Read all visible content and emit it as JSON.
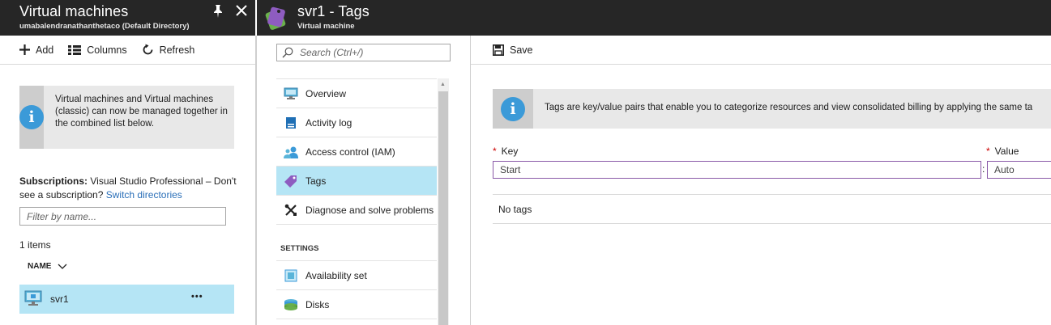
{
  "blade1": {
    "title": "Virtual machines",
    "subtitle": "umabalendranathanthetaco (Default Directory)",
    "pin_icon": "pin-icon",
    "close_icon": "close-icon",
    "toolbar": {
      "add": "Add",
      "columns": "Columns",
      "refresh": "Refresh"
    },
    "info_text": "Virtual machines and Virtual machines (classic) can now be managed together in the combined list below.",
    "subscriptions_label": "Subscriptions:",
    "subscriptions_text": "Visual Studio Professional – Don't see a subscription?",
    "switch_link": "Switch directories",
    "filter_placeholder": "Filter by name...",
    "items_count": "1 items",
    "col_name": "NAME",
    "row_name": "svr1",
    "row_more": "•••"
  },
  "blade2": {
    "title": "svr1 - Tags",
    "subtitle": "Virtual machine",
    "search_placeholder": "Search (Ctrl+/)",
    "menu": [
      {
        "label": "Overview",
        "icon": "monitor-icon"
      },
      {
        "label": "Activity log",
        "icon": "log-icon"
      },
      {
        "label": "Access control (IAM)",
        "icon": "users-icon"
      },
      {
        "label": "Tags",
        "icon": "tag-icon"
      },
      {
        "label": "Diagnose and solve problems",
        "icon": "tools-icon"
      }
    ],
    "settings_header": "SETTINGS",
    "settings_menu": [
      {
        "label": "Availability set",
        "icon": "availability-icon"
      },
      {
        "label": "Disks",
        "icon": "disks-icon"
      }
    ]
  },
  "tags": {
    "save": "Save",
    "info_text": "Tags are key/value pairs that enable you to categorize resources and view consolidated billing by applying the same ta",
    "required_star": "*",
    "key_label": "Key",
    "value_label": "Value",
    "key_value": "Start",
    "separator": ":",
    "value_value": "Auto",
    "no_tags": "No tags"
  },
  "colors": {
    "header_bg": "#262626",
    "selected_bg": "#b5e5f5",
    "accent_blue": "#3b9ad8",
    "required_red": "#c00",
    "input_focus": "#8a5aa8"
  }
}
